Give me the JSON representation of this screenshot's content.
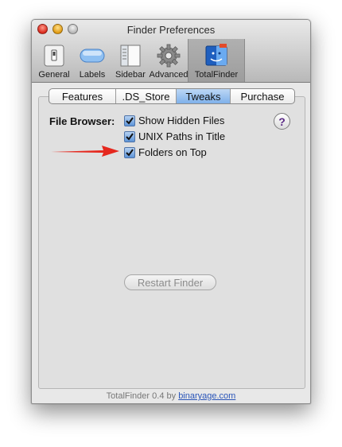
{
  "window": {
    "title": "Finder Preferences"
  },
  "toolbar": {
    "items": [
      {
        "label": "General",
        "icon": "general-switch-icon"
      },
      {
        "label": "Labels",
        "icon": "labels-pill-icon"
      },
      {
        "label": "Sidebar",
        "icon": "sidebar-icon"
      },
      {
        "label": "Advanced",
        "icon": "gear-icon"
      },
      {
        "label": "TotalFinder",
        "icon": "totalfinder-icon",
        "selected": true
      }
    ]
  },
  "tabs": [
    {
      "label": "Features"
    },
    {
      "label": ".DS_Store"
    },
    {
      "label": "Tweaks",
      "active": true
    },
    {
      "label": "Purchase"
    }
  ],
  "file_browser": {
    "label": "File Browser:",
    "options": [
      {
        "label": "Show Hidden Files",
        "checked": true
      },
      {
        "label": "UNIX Paths in Title",
        "checked": true
      },
      {
        "label": "Folders on Top",
        "checked": true
      }
    ]
  },
  "help": {
    "glyph": "?"
  },
  "restart_button": {
    "label": "Restart Finder",
    "enabled": false
  },
  "footer": {
    "product": "TotalFinder",
    "version": "0.4",
    "by": "by",
    "link": "binaryage.com"
  },
  "colors": {
    "accent": "#7fb1ea",
    "arrow": "#e5281e",
    "link": "#2a55b8"
  }
}
